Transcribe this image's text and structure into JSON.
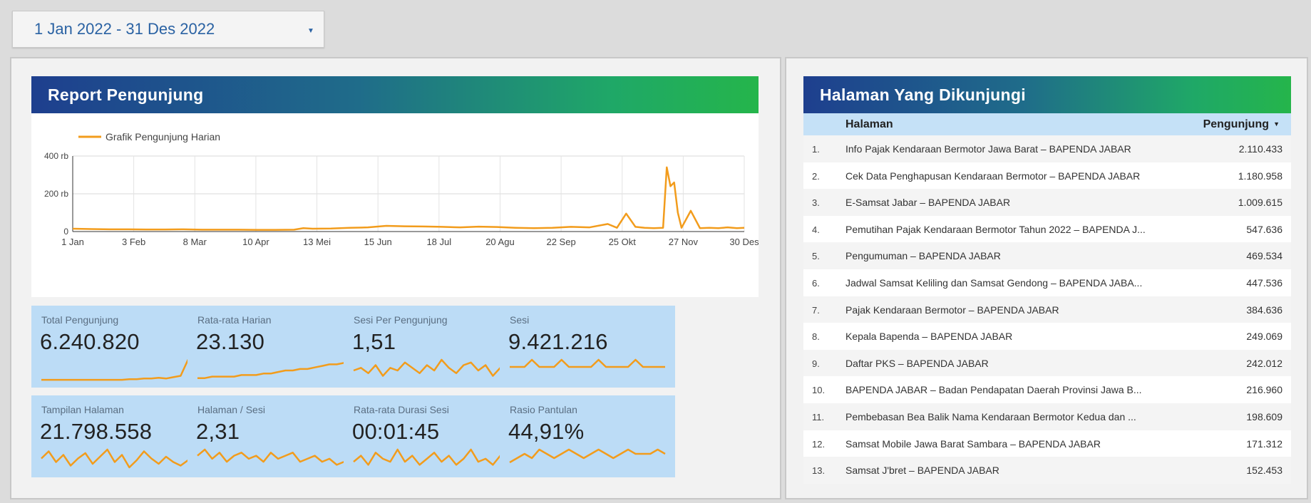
{
  "date_range": {
    "label": "1 Jan 2022 - 31 Des 2022"
  },
  "report": {
    "title": "Report Pengunjung",
    "legend": "Grafik Pengunjung Harian"
  },
  "chart_data": {
    "type": "line",
    "title": "",
    "xlabel": "",
    "ylabel": "",
    "ylim": [
      0,
      400000
    ],
    "y_ticks": [
      "0",
      "200 rb",
      "400 rb"
    ],
    "x_ticks": [
      "1 Jan",
      "3 Feb",
      "8 Mar",
      "10 Apr",
      "13 Mei",
      "15 Jun",
      "18 Jul",
      "20 Agu",
      "22 Sep",
      "25 Okt",
      "27 Nov",
      "30 Des"
    ],
    "grid": true,
    "legend_position": "top-left",
    "color": "#f29c1c",
    "series": [
      {
        "name": "Grafik Pengunjung Harian",
        "x": [
          0,
          10,
          20,
          30,
          40,
          50,
          60,
          70,
          80,
          90,
          100,
          110,
          120,
          125,
          130,
          140,
          150,
          160,
          170,
          180,
          190,
          200,
          210,
          220,
          230,
          240,
          250,
          260,
          270,
          280,
          290,
          295,
          300,
          305,
          310,
          315,
          320,
          322,
          324,
          326,
          328,
          330,
          335,
          340,
          345,
          350,
          355,
          360,
          364
        ],
        "y": [
          15000,
          13000,
          12000,
          12000,
          11000,
          11000,
          12000,
          10000,
          10000,
          10000,
          9000,
          9000,
          10000,
          18000,
          15000,
          16000,
          20000,
          22000,
          30000,
          28000,
          27000,
          25000,
          22000,
          26000,
          24000,
          20000,
          18000,
          20000,
          25000,
          22000,
          40000,
          20000,
          95000,
          25000,
          20000,
          18000,
          20000,
          340000,
          240000,
          260000,
          100000,
          20000,
          110000,
          18000,
          20000,
          18000,
          22000,
          18000,
          20000
        ]
      }
    ]
  },
  "kpis": [
    {
      "label": "Total Pengunjung",
      "value": "6.240.820",
      "spark": [
        10,
        10,
        10,
        10,
        10,
        10,
        10,
        10,
        10,
        10,
        10,
        10,
        11,
        11,
        12,
        12,
        13,
        12,
        14,
        16,
        40,
        12
      ]
    },
    {
      "label": "Rata-rata Harian",
      "value": "23.130",
      "spark": [
        10,
        10,
        11,
        11,
        11,
        11,
        12,
        12,
        12,
        13,
        13,
        14,
        15,
        15,
        16,
        16,
        17,
        18,
        19,
        19,
        20,
        22
      ]
    },
    {
      "label": "Sesi Per Pengunjung",
      "value": "1,51",
      "spark": [
        14,
        15,
        13,
        16,
        12,
        15,
        14,
        17,
        15,
        13,
        16,
        14,
        18,
        15,
        13,
        16,
        17,
        14,
        16,
        12,
        15,
        14
      ]
    },
    {
      "label": "Sesi",
      "value": "9.421.216",
      "spark": [
        14,
        14,
        14,
        15,
        14,
        14,
        14,
        15,
        14,
        14,
        14,
        14,
        15,
        14,
        14,
        14,
        14,
        15,
        14,
        14,
        14,
        14
      ]
    },
    {
      "label": "Tampilan Halaman",
      "value": "21.798.558",
      "spark": [
        16,
        20,
        14,
        18,
        12,
        16,
        19,
        13,
        17,
        21,
        14,
        18,
        11,
        15,
        20,
        16,
        13,
        17,
        14,
        12,
        15,
        14
      ]
    },
    {
      "label": "Halaman / Sesi",
      "value": "2,31",
      "spark": [
        16,
        18,
        15,
        17,
        14,
        16,
        17,
        15,
        16,
        14,
        17,
        15,
        16,
        17,
        14,
        15,
        16,
        14,
        15,
        13,
        14,
        14
      ]
    },
    {
      "label": "Rata-rata Durasi Sesi",
      "value": "00:01:45",
      "spark": [
        14,
        16,
        13,
        17,
        15,
        14,
        18,
        14,
        16,
        13,
        15,
        17,
        14,
        16,
        13,
        15,
        18,
        14,
        15,
        13,
        16,
        14
      ]
    },
    {
      "label": "Rasio Pantulan",
      "value": "44,91%",
      "spark": [
        14,
        15,
        16,
        15,
        17,
        16,
        15,
        16,
        17,
        16,
        15,
        16,
        17,
        16,
        15,
        16,
        17,
        16,
        16,
        16,
        17,
        16
      ]
    }
  ],
  "pages": {
    "title": "Halaman Yang Dikunjungi",
    "col_page": "Halaman",
    "col_visits": "Pengunjung",
    "rows": [
      {
        "idx": "1.",
        "page": "Info Pajak Kendaraan Bermotor Jawa Barat – BAPENDA JABAR",
        "val": "2.110.433"
      },
      {
        "idx": "2.",
        "page": "Cek Data Penghapusan Kendaraan Bermotor – BAPENDA JABAR",
        "val": "1.180.958"
      },
      {
        "idx": "3.",
        "page": "E-Samsat Jabar – BAPENDA JABAR",
        "val": "1.009.615"
      },
      {
        "idx": "4.",
        "page": "Pemutihan Pajak Kendaraan Bermotor Tahun 2022 – BAPENDA J...",
        "val": "547.636"
      },
      {
        "idx": "5.",
        "page": "Pengumuman – BAPENDA JABAR",
        "val": "469.534"
      },
      {
        "idx": "6.",
        "page": "Jadwal Samsat Keliling dan Samsat Gendong – BAPENDA JABA...",
        "val": "447.536"
      },
      {
        "idx": "7.",
        "page": "Pajak Kendaraan Bermotor – BAPENDA JABAR",
        "val": "384.636"
      },
      {
        "idx": "8.",
        "page": "Kepala Bapenda – BAPENDA JABAR",
        "val": "249.069"
      },
      {
        "idx": "9.",
        "page": "Daftar PKS – BAPENDA JABAR",
        "val": "242.012"
      },
      {
        "idx": "10.",
        "page": "BAPENDA JABAR – Badan Pendapatan Daerah Provinsi Jawa B...",
        "val": "216.960"
      },
      {
        "idx": "11.",
        "page": "Pembebasan Bea Balik Nama Kendaraan Bermotor Kedua dan ...",
        "val": "198.609"
      },
      {
        "idx": "12.",
        "page": "Samsat Mobile Jawa Barat Sambara – BAPENDA JABAR",
        "val": "171.312"
      },
      {
        "idx": "13.",
        "page": "Samsat J'bret – BAPENDA JABAR",
        "val": "152.453"
      }
    ]
  }
}
